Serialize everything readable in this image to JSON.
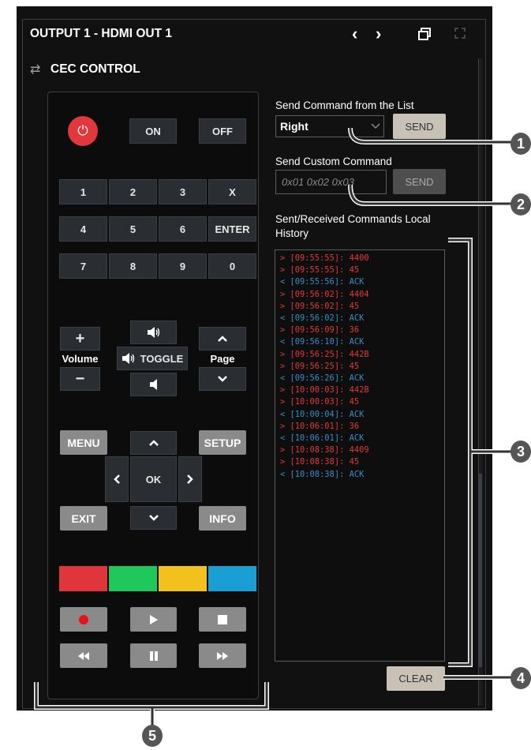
{
  "colors": {
    "panel_bg": "#111111",
    "sent": "#e0383c",
    "received": "#3a8cc1",
    "power": "#e0383c",
    "red": "#e0353b",
    "green": "#1ec85a",
    "yellow": "#f2c11b",
    "blue": "#199fd3"
  },
  "header": {
    "title": "OUTPUT 1 - HDMI OUT 1",
    "prev_icon": "‹",
    "next_icon": "›"
  },
  "section": {
    "title": "CEC CONTROL",
    "icon": "⇄"
  },
  "remote": {
    "power_icon": "⏻",
    "on": "ON",
    "off": "OFF",
    "numpad": [
      [
        "1",
        "2",
        "3",
        "X"
      ],
      [
        "4",
        "5",
        "6",
        "ENTER"
      ],
      [
        "7",
        "8",
        "9",
        "0"
      ]
    ],
    "volume_label": "Volume",
    "volume_plus": "+",
    "volume_minus": "−",
    "page_label": "Page",
    "toggle_label": "TOGGLE",
    "menu": "MENU",
    "setup": "SETUP",
    "ok": "OK",
    "exit": "EXIT",
    "info": "INFO"
  },
  "send_list": {
    "label": "Send Command from the List",
    "selected": "Right",
    "send": "SEND"
  },
  "send_custom": {
    "label": "Send Custom Command",
    "placeholder": "0x01 0x02 0x03",
    "send": "SEND"
  },
  "history": {
    "label": "Sent/Received Commands Local History",
    "entries": [
      {
        "dir": "sent",
        "text": "> [09:55:55]: 4400"
      },
      {
        "dir": "sent",
        "text": "> [09:55:55]: 45"
      },
      {
        "dir": "recv",
        "text": "< [09:55:56]: ACK"
      },
      {
        "dir": "sent",
        "text": "> [09:56:02]: 4404"
      },
      {
        "dir": "sent",
        "text": "> [09:56:02]: 45"
      },
      {
        "dir": "recv",
        "text": "< [09:56:02]: ACK"
      },
      {
        "dir": "sent",
        "text": "> [09:56:09]: 36"
      },
      {
        "dir": "recv",
        "text": "< [09:56:10]: ACK"
      },
      {
        "dir": "sent",
        "text": "> [09:56:25]: 442B"
      },
      {
        "dir": "sent",
        "text": "> [09:56:25]: 45"
      },
      {
        "dir": "recv",
        "text": "< [09:56:26]: ACK"
      },
      {
        "dir": "sent",
        "text": "> [10:00:03]: 442B"
      },
      {
        "dir": "sent",
        "text": "> [10:00:03]: 45"
      },
      {
        "dir": "recv",
        "text": "< [10:00:04]: ACK"
      },
      {
        "dir": "sent",
        "text": "> [10:06:01]: 36"
      },
      {
        "dir": "recv",
        "text": "< [10:06:01]: ACK"
      },
      {
        "dir": "sent",
        "text": "> [10:08:38]: 4409"
      },
      {
        "dir": "sent",
        "text": "> [10:08:38]: 45"
      },
      {
        "dir": "recv",
        "text": "< [10:08:38]: ACK"
      }
    ],
    "clear": "CLEAR"
  },
  "callouts": [
    "1",
    "2",
    "3",
    "4",
    "5"
  ]
}
